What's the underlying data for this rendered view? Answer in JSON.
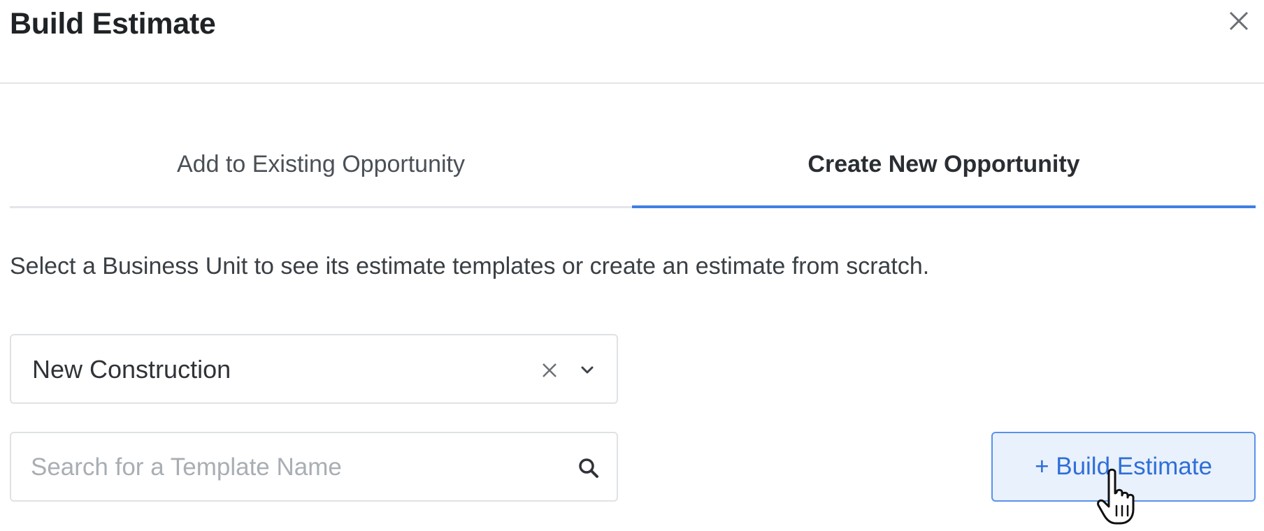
{
  "modal": {
    "title": "Build Estimate"
  },
  "tabs": [
    {
      "label": "Add to Existing Opportunity",
      "active": false
    },
    {
      "label": "Create New Opportunity",
      "active": true
    }
  ],
  "description": "Select a Business Unit to see its estimate templates or create an estimate from scratch.",
  "business_unit": {
    "value": "New Construction"
  },
  "search": {
    "value": "",
    "placeholder": "Search for a Template Name"
  },
  "build_button": {
    "label": "+ Build Estimate"
  },
  "icons": {
    "close": "close-icon",
    "clear": "clear-icon",
    "dropdown": "chevron-down-icon",
    "search": "search-icon",
    "cursor": "hand-pointer-icon"
  },
  "colors": {
    "accent": "#3f7fe5",
    "button_bg": "#e9f1fd",
    "button_text": "#2f6fd8"
  }
}
